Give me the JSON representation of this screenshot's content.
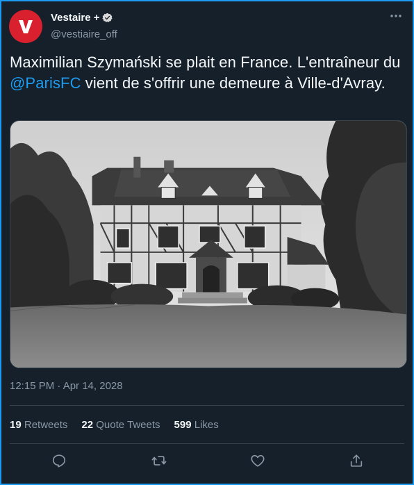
{
  "author": {
    "display_name": "Vestaire +",
    "handle": "@vestiaire_off",
    "avatar_letter": "V",
    "brand_color": "#d8202f"
  },
  "tweet": {
    "text_before": "Maximilian Szymański se plait en France. L'entraîneur du ",
    "mention": "@ParisFC",
    "text_after": " vient de s'offrir une demeure à Ville-d'Avray.",
    "timestamp": "12:15 PM · Apr 14, 2028"
  },
  "stats": {
    "retweets_count": "19",
    "retweets_label": "Retweets",
    "quotes_count": "22",
    "quotes_label": "Quote Tweets",
    "likes_count": "599",
    "likes_label": "Likes"
  },
  "actions": [
    "reply-icon",
    "retweet-icon",
    "like-icon",
    "share-icon"
  ],
  "colors": {
    "accent": "#1d9bf0",
    "background": "#15202b",
    "muted": "#8b98a5"
  }
}
